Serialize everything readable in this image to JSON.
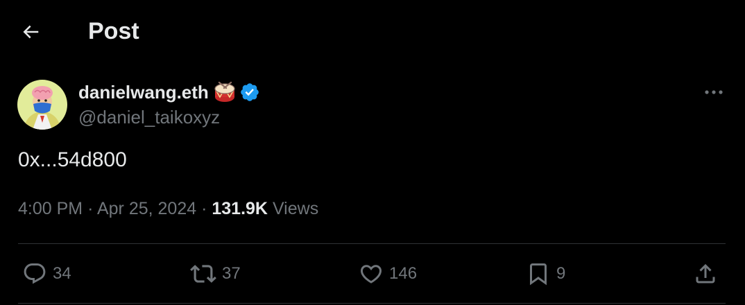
{
  "header": {
    "title": "Post",
    "back_icon": "arrow-left-icon"
  },
  "author": {
    "display_name": "danielwang.eth",
    "handle": "@daniel_taikoxyz",
    "badges": [
      "drum-emoji-icon",
      "verified-badge-icon"
    ],
    "verified_color": "#1d9bf0"
  },
  "post": {
    "text": "0x...54d800",
    "time": "4:00 PM",
    "separator": "·",
    "date": "Apr 25, 2024",
    "views_count": "131.9K",
    "views_label": "Views"
  },
  "actions": {
    "reply": {
      "icon": "reply-icon",
      "count": "34"
    },
    "repost": {
      "icon": "repost-icon",
      "count": "37"
    },
    "like": {
      "icon": "heart-icon",
      "count": "146"
    },
    "bookmark": {
      "icon": "bookmark-icon",
      "count": "9"
    },
    "share": {
      "icon": "share-icon"
    }
  },
  "colors": {
    "background": "#000000",
    "primary_text": "#e7e9ea",
    "secondary_text": "#71767b",
    "divider": "#2f3336"
  }
}
